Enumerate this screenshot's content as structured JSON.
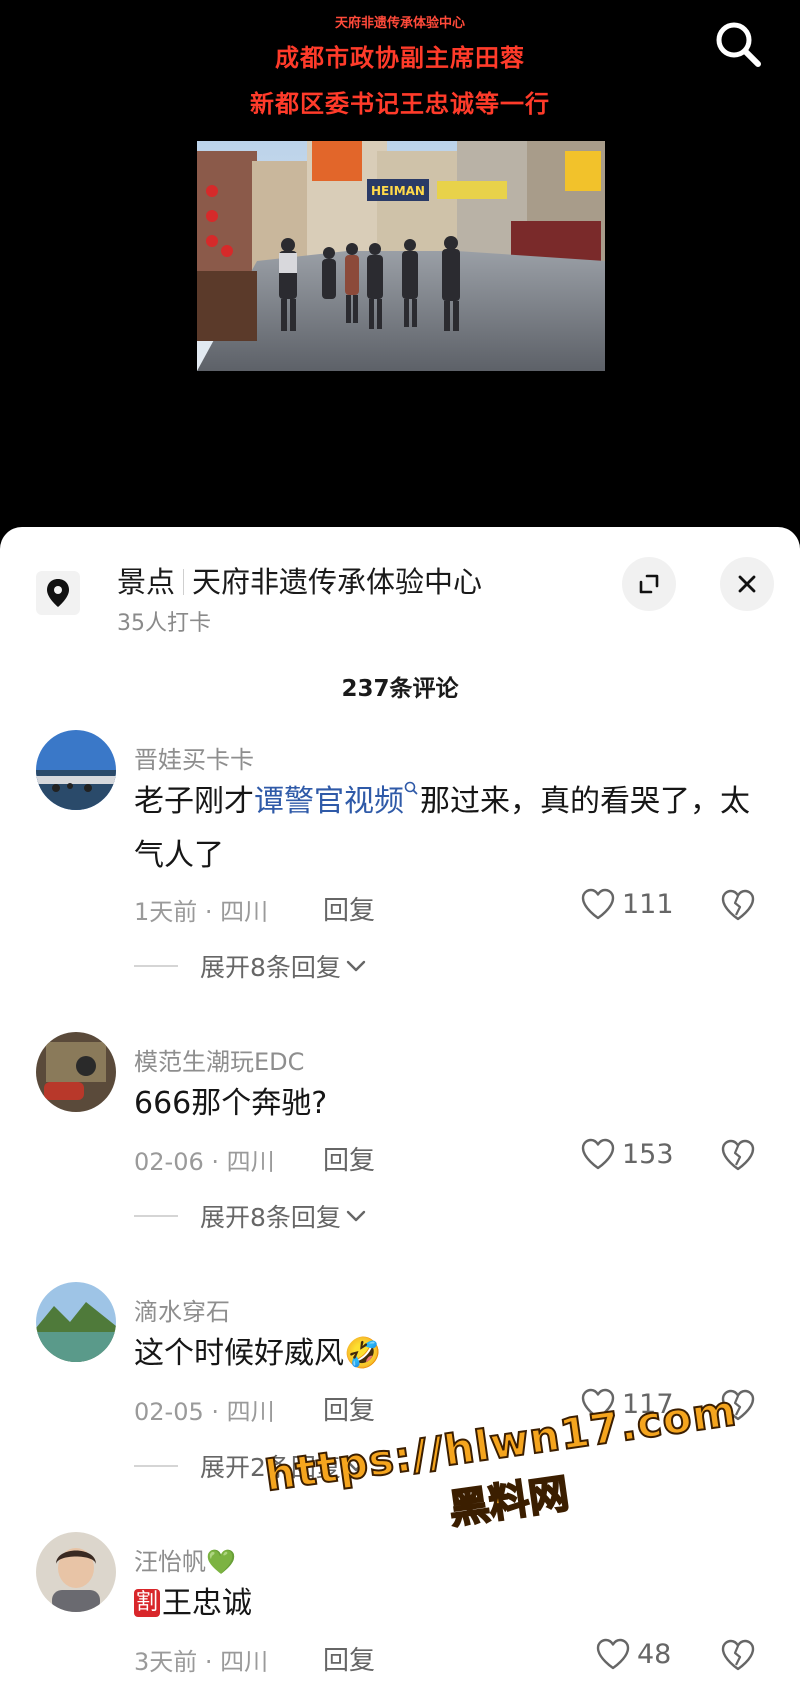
{
  "video": {
    "caption_small": "天府非遗传承体验中心",
    "caption_line1": "成都市政协副主席田蓉",
    "caption_line2": "新都区委书记王忠诚等一行",
    "sign_text": "HEIMAN"
  },
  "poi": {
    "category": "景点",
    "name": "天府非遗传承体验中心",
    "checkins": "35人打卡"
  },
  "comment_count": "237条评论",
  "comments": [
    {
      "username": "晋娃买卡卡",
      "text_before": "老子刚才",
      "link": "谭警官视频",
      "text_after": "那过来，真的看哭了，太气人了",
      "meta": "1天前 · 四川",
      "reply_label": "回复",
      "likes": "111",
      "expand": "展开8条回复"
    },
    {
      "username": "模范生潮玩EDC",
      "text": "666那个奔驰?",
      "meta": "02-06 · 四川",
      "reply_label": "回复",
      "likes": "153",
      "expand": "展开8条回复"
    },
    {
      "username": "滴水穿石",
      "text": "这个时候好威风",
      "emoji": "🤣",
      "meta": "02-05 · 四川",
      "reply_label": "回复",
      "likes": "117",
      "expand": "展开2条回复"
    },
    {
      "username": "汪怡帆",
      "username_emoji": "💚",
      "tag": "割",
      "text": "王忠诚",
      "meta": "3天前 · 四川",
      "reply_label": "回复",
      "likes": "48"
    }
  ],
  "watermark": {
    "line1": "https://hlwn17.com",
    "line2": "黑料网"
  },
  "colors": {
    "caption_red": "#ff3b2a",
    "link_blue": "#2f5aa8",
    "watermark_orange": "#f5a51e"
  }
}
